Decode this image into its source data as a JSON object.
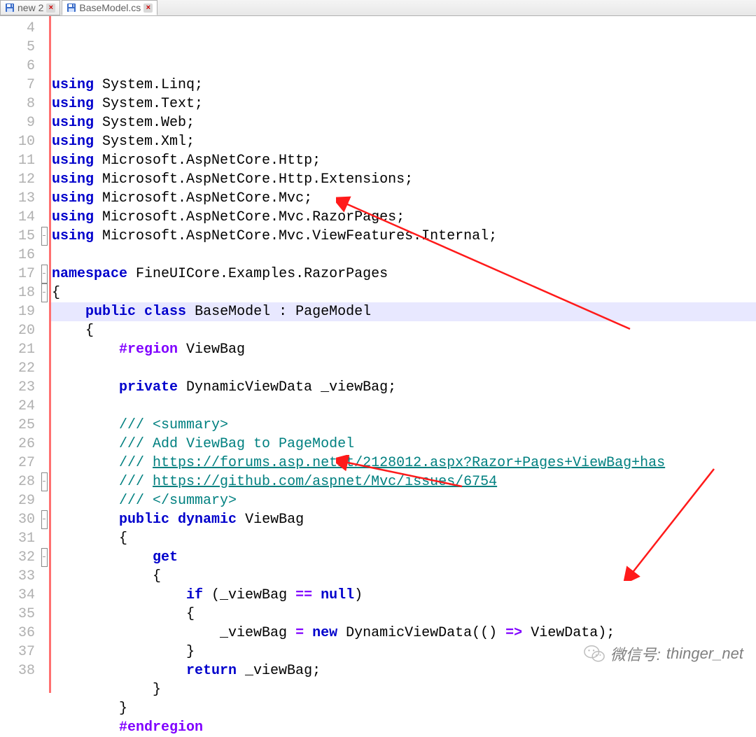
{
  "tabs": [
    {
      "label": "new 2",
      "active": false
    },
    {
      "label": "BaseModel.cs",
      "active": true
    }
  ],
  "gutter_start": 4,
  "gutter_end": 38,
  "highlight_line": 16,
  "fold_marks": {
    "15": "-",
    "17": "-",
    "18": "-",
    "28": "-",
    "30": "-",
    "32": "-"
  },
  "code": {
    "l4": {
      "kw": "using",
      "rest": " System.Linq;"
    },
    "l5": {
      "kw": "using",
      "rest": " System.Text;"
    },
    "l6": {
      "kw": "using",
      "rest": " System.Web;"
    },
    "l7": {
      "kw": "using",
      "rest": " System.Xml;"
    },
    "l8": {
      "kw": "using",
      "rest": " Microsoft.AspNetCore.Http;"
    },
    "l9": {
      "kw": "using",
      "rest": " Microsoft.AspNetCore.Http.Extensions;"
    },
    "l10": {
      "kw": "using",
      "rest": " Microsoft.AspNetCore.Mvc;"
    },
    "l11": {
      "kw": "using",
      "rest": " Microsoft.AspNetCore.Mvc.RazorPages;"
    },
    "l12": {
      "kw": "using",
      "rest": " Microsoft.AspNetCore.Mvc.ViewFeatures.Internal;"
    },
    "l14": {
      "kw": "namespace",
      "rest": " FineUICore.Examples.RazorPages"
    },
    "l15": "{",
    "l16": {
      "pre": "    ",
      "kw1": "public",
      "sp1": " ",
      "kw2": "class",
      "rest": " BaseModel : PageModel"
    },
    "l17": "    {",
    "l18": {
      "pre": "        ",
      "region": "#region",
      "rest": " ViewBag"
    },
    "l20": {
      "pre": "        ",
      "kw": "private",
      "rest": " DynamicViewData _viewBag;"
    },
    "l22": {
      "pre": "        ",
      "c": "/// <summary>"
    },
    "l23": {
      "pre": "        ",
      "c": "/// Add ViewBag to PageModel"
    },
    "l24": {
      "pre": "        ",
      "c": "/// ",
      "link": "https://forums.asp.net/t/2128012.aspx?Razor+Pages+ViewBag+has"
    },
    "l25": {
      "pre": "        ",
      "c": "/// ",
      "link": "https://github.com/aspnet/Mvc/issues/6754"
    },
    "l26": {
      "pre": "        ",
      "c": "/// </summary>"
    },
    "l27": {
      "pre": "        ",
      "kw1": "public",
      "sp": " ",
      "kw2": "dynamic",
      "rest": " ViewBag"
    },
    "l28": "        {",
    "l29": {
      "pre": "            ",
      "kw": "get"
    },
    "l30": "            {",
    "l31": {
      "pre": "                ",
      "kw": "if",
      "rest1": " (_viewBag ",
      "op": "==",
      "rest2": " ",
      "kw2": "null",
      "rest3": ")"
    },
    "l32": "                {",
    "l33": {
      "pre": "                    ",
      "r1": "_viewBag ",
      "op": "=",
      "sp": " ",
      "kw": "new",
      "r2": " DynamicViewData(() ",
      "op2": "=>",
      "r3": " ViewData);"
    },
    "l34": "                }",
    "l35": {
      "pre": "                ",
      "kw": "return",
      "rest": " _viewBag;"
    },
    "l36": "            }",
    "l37": "        }",
    "l38": {
      "pre": "        ",
      "region": "#endregion"
    }
  },
  "watermark": {
    "label": "微信号:",
    "value": "thinger_net"
  }
}
